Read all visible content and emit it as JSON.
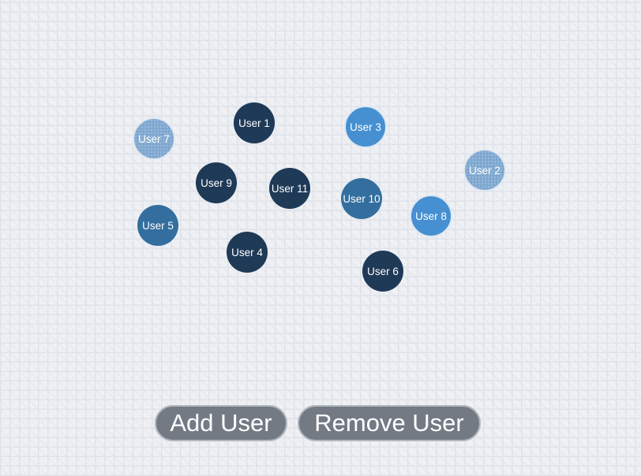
{
  "users": [
    {
      "label": "User 1",
      "tone": "dark"
    },
    {
      "label": "User 3",
      "tone": "light"
    },
    {
      "label": "User 7",
      "tone": "pale"
    },
    {
      "label": "User 2",
      "tone": "pale"
    },
    {
      "label": "User 9",
      "tone": "dark"
    },
    {
      "label": "User 11",
      "tone": "dark"
    },
    {
      "label": "User 10",
      "tone": "mid"
    },
    {
      "label": "User 8",
      "tone": "light"
    },
    {
      "label": "User 5",
      "tone": "mid"
    },
    {
      "label": "User 4",
      "tone": "dark"
    },
    {
      "label": "User 6",
      "tone": "dark"
    }
  ],
  "controls": {
    "add_label": "Add User",
    "remove_label": "Remove User"
  },
  "colors": {
    "node_dark": "#1f3a57",
    "node_mid": "#336e9e",
    "node_light": "#4690d1",
    "node_pale": "#7fa8d0",
    "button": "#737a84",
    "background": "#eef0f4"
  }
}
